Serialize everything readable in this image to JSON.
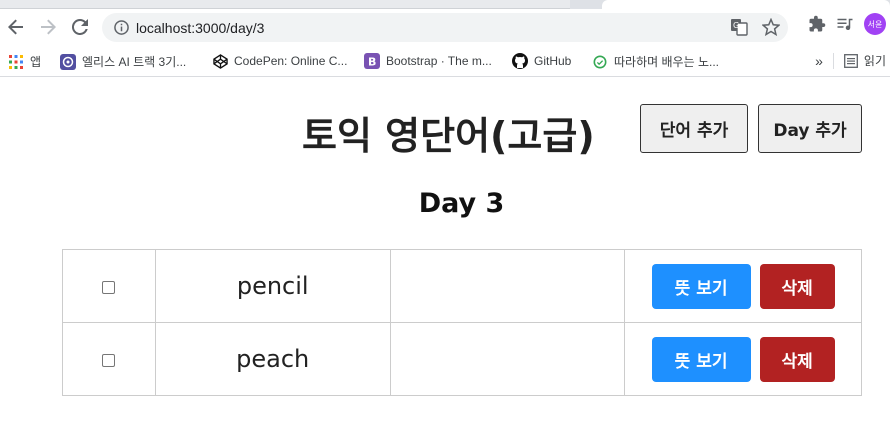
{
  "browser": {
    "url": "localhost:3000/day/3",
    "avatar_label": "서윤",
    "bookmarks": [
      {
        "label": "앱",
        "icon": "apps-grid-icon"
      },
      {
        "label": "엘리스 AI 트랙 3기...",
        "icon": "elice-icon"
      },
      {
        "label": "CodePen: Online C...",
        "icon": "codepen-icon"
      },
      {
        "label": "Bootstrap · The m...",
        "icon": "bootstrap-icon"
      },
      {
        "label": "GitHub",
        "icon": "github-icon"
      },
      {
        "label": "따라하며 배우는 노...",
        "icon": "site-icon"
      }
    ],
    "more_label": "»",
    "reading_list_label": "읽기"
  },
  "header": {
    "title": "토익 영단어(고급)",
    "add_word_label": "단어 추가",
    "add_day_label": "Day 추가"
  },
  "day": {
    "title": "Day 3"
  },
  "words": [
    {
      "word": "pencil",
      "meaning": "",
      "show_label": "뜻 보기",
      "delete_label": "삭제"
    },
    {
      "word": "peach",
      "meaning": "",
      "show_label": "뜻 보기",
      "delete_label": "삭제"
    }
  ],
  "colors": {
    "show_button": "#1e90ff",
    "delete_button": "#b22222",
    "avatar": "#a142f4"
  }
}
